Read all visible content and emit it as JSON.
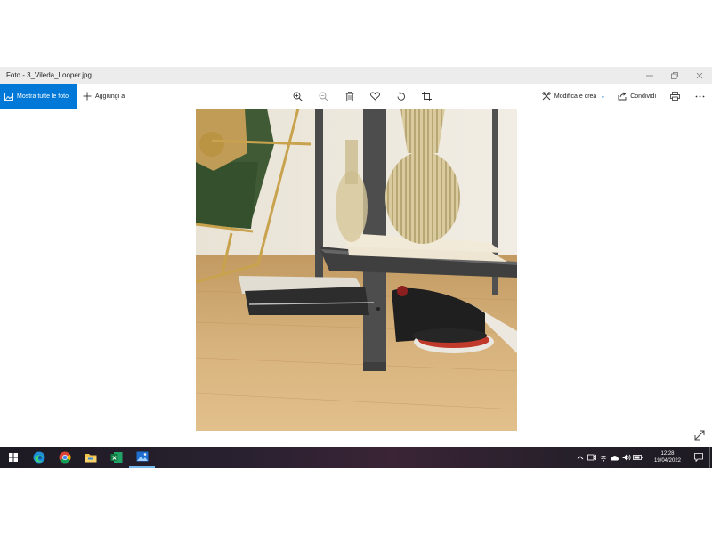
{
  "window": {
    "title": "Foto - 3_Vileda_Looper.jpg"
  },
  "toolbar": {
    "show_all_label": "Mostra tutte le foto",
    "add_to_label": "Aggiungi a",
    "edit_create_label": "Modifica e crea",
    "share_label": "Condividi"
  },
  "taskbar": {
    "time": "12:28",
    "date": "19/04/2022"
  },
  "colors": {
    "accent": "#0078d7",
    "titlebar_bg": "#ececec",
    "taskbar_bg": "#221d28"
  },
  "icons": {
    "toolbar_center": [
      "zoom-in-icon",
      "zoom-out-icon",
      "delete-icon",
      "favorite-heart-icon",
      "rotate-icon",
      "crop-icon"
    ],
    "toolbar_right": [
      "edit-create-icon",
      "share-icon",
      "print-icon",
      "more-icon"
    ],
    "taskbar_apps": [
      "start-icon",
      "edge-icon",
      "chrome-icon",
      "file-explorer-icon",
      "excel-icon",
      "photos-icon"
    ],
    "tray": [
      "tray-overflow-icon",
      "meet-now-icon",
      "network-icon",
      "onedrive-icon",
      "volume-icon",
      "battery-icon"
    ]
  }
}
